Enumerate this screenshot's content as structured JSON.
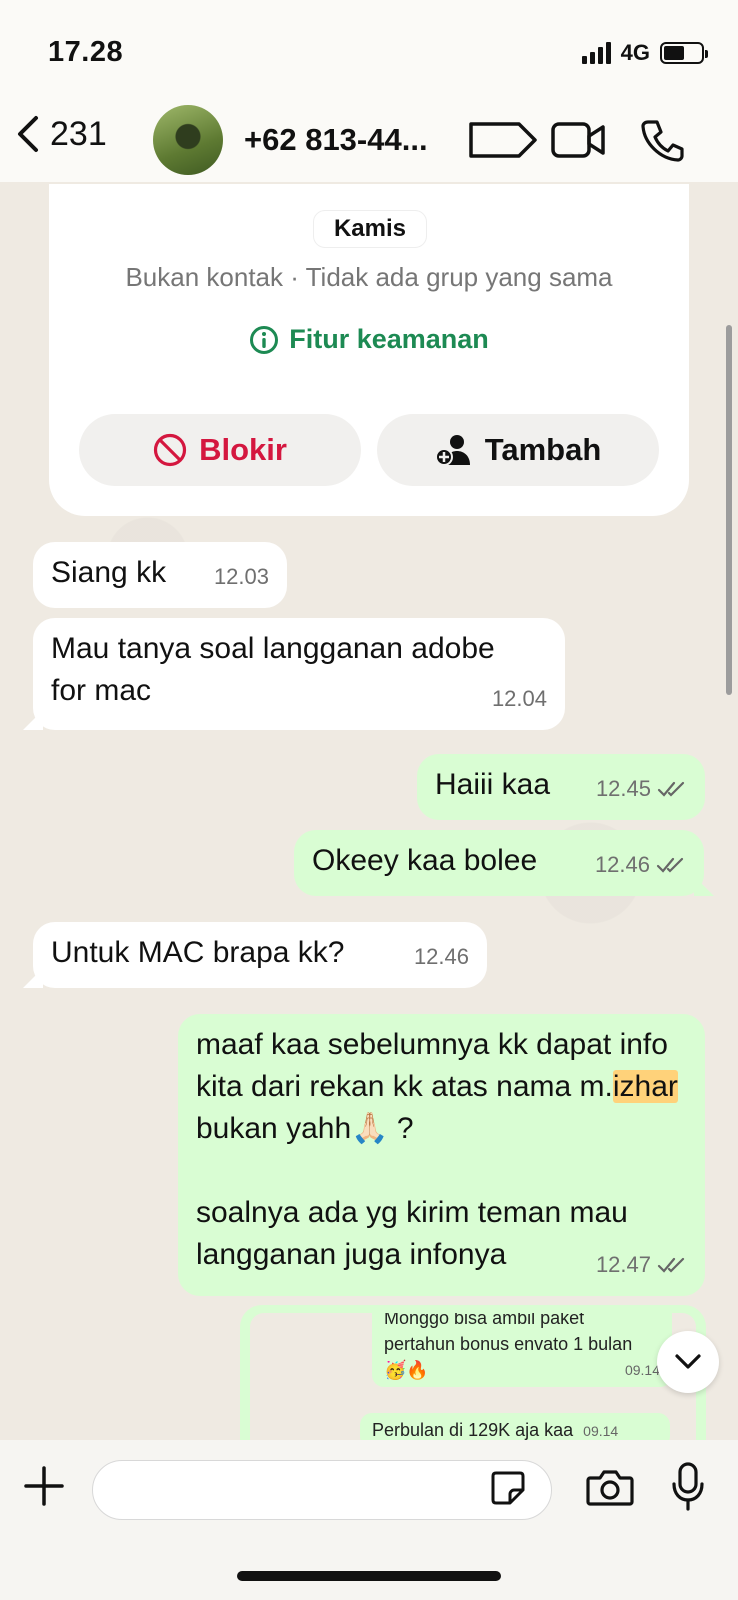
{
  "status_bar": {
    "time": "17.28",
    "network": "4G"
  },
  "header": {
    "back_count": "231",
    "contact_name": "+62 813-44..."
  },
  "card": {
    "day_label": "Kamis",
    "meta": "Bukan kontak · Tidak ada grup yang sama",
    "security": "Fitur keamanan",
    "block_label": "Blokir",
    "add_label": "Tambah"
  },
  "messages": [
    {
      "dir": "in",
      "text": "Siang kk",
      "time": "12.03"
    },
    {
      "dir": "in",
      "text": "Mau tanya soal langganan adobe for mac",
      "time": "12.04"
    },
    {
      "dir": "out",
      "text": "Haiii kaa",
      "time": "12.45"
    },
    {
      "dir": "out",
      "text": "Okeey kaa bolee",
      "time": "12.46"
    },
    {
      "dir": "in",
      "text": "Untuk MAC brapa kk?",
      "time": "12.46"
    },
    {
      "dir": "out",
      "text_a": "maaf kaa sebelumnya kk dapat info kita dari rekan kk atas nama m.",
      "highlight": "izhar",
      "text_b": " bukan yahh🙏🏻 ?",
      "text_c": "soalnya ada yg kirim teman mau langganan juga infonya",
      "time": "12.47"
    }
  ],
  "forwarded": {
    "line1": "Monggo bisa ambil paket",
    "line2": "pertahun bonus envato 1 bulan",
    "line3": "🥳🔥",
    "time1": "09.14",
    "line4": "Perbulan di 129K aja kaa",
    "time2": "09.14"
  },
  "colors": {
    "accent_green": "#1d8a53",
    "block_red": "#d4173f",
    "outgoing_bubble": "#d9fdd3",
    "highlight": "#ffd27a"
  }
}
